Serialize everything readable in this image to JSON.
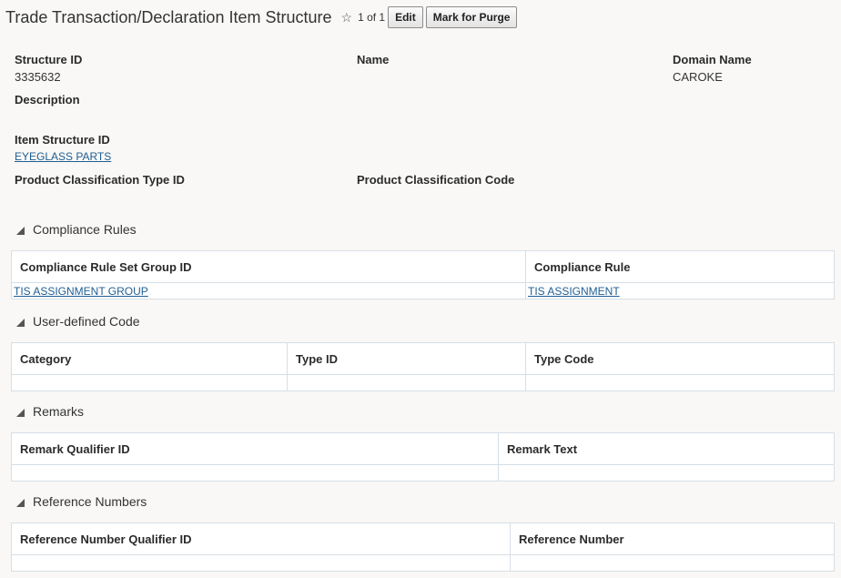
{
  "header": {
    "title": "Trade Transaction/Declaration Item Structure",
    "pager": "1 of 1",
    "edit_label": "Edit",
    "purge_label": "Mark for Purge"
  },
  "fields": {
    "structure_id": {
      "label": "Structure ID",
      "value": "3335632"
    },
    "name": {
      "label": "Name",
      "value": ""
    },
    "domain_name": {
      "label": "Domain Name",
      "value": "CAROKE"
    },
    "description": {
      "label": "Description",
      "value": ""
    },
    "item_structure_id": {
      "label": "Item Structure ID",
      "value": "EYEGLASS PARTS"
    },
    "product_classification_type_id": {
      "label": "Product Classification Type ID",
      "value": ""
    },
    "product_classification_code": {
      "label": "Product Classification Code",
      "value": ""
    }
  },
  "sections": {
    "compliance_rules": {
      "title": "Compliance Rules",
      "columns": [
        "Compliance Rule Set Group ID",
        "Compliance Rule"
      ],
      "rows": [
        [
          "TIS ASSIGNMENT GROUP",
          "TIS ASSIGNMENT"
        ]
      ]
    },
    "user_defined_code": {
      "title": "User-defined Code",
      "columns": [
        "Category",
        "Type ID",
        "Type Code"
      ],
      "rows": [
        [
          "",
          "",
          ""
        ]
      ]
    },
    "remarks": {
      "title": "Remarks",
      "columns": [
        "Remark Qualifier ID",
        "Remark Text"
      ],
      "rows": [
        [
          "",
          ""
        ]
      ]
    },
    "reference_numbers": {
      "title": "Reference Numbers",
      "columns": [
        "Reference Number Qualifier ID",
        "Reference Number"
      ],
      "rows": [
        [
          "",
          ""
        ]
      ]
    }
  }
}
